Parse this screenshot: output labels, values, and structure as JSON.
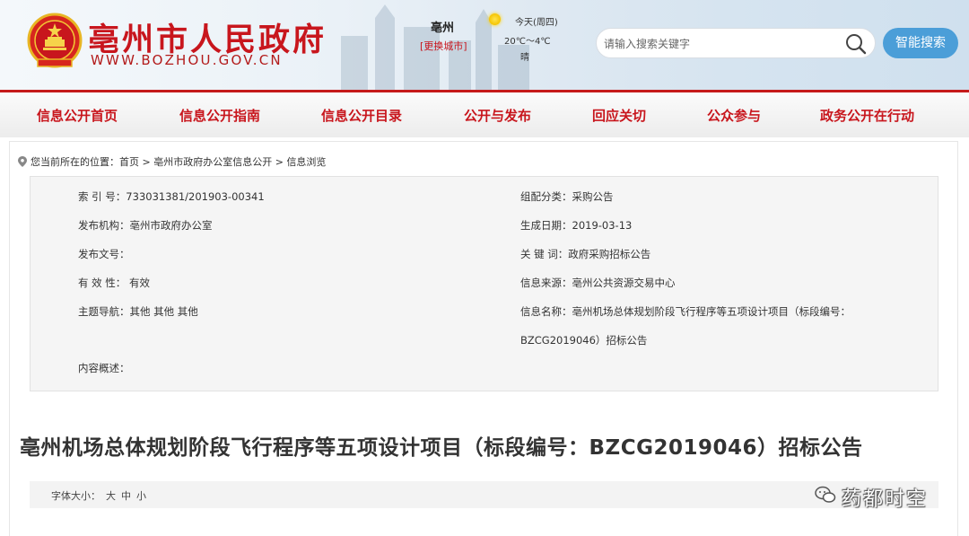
{
  "header": {
    "site_title": "亳州市人民政府",
    "site_url": "WWW.BOZHOU.GOV.CN",
    "city": "亳州",
    "switch_city": "[更换城市]",
    "weather": {
      "day": "今天(周四)",
      "temp": "20℃～4℃",
      "condition": "晴",
      "icon": "sun-icon"
    },
    "search_placeholder": "请输入搜索关键字",
    "smart_search_label": "智能搜索"
  },
  "nav": {
    "items": [
      {
        "label": "信息公开首页"
      },
      {
        "label": "信息公开指南"
      },
      {
        "label": "信息公开目录"
      },
      {
        "label": "公开与发布"
      },
      {
        "label": "回应关切"
      },
      {
        "label": "公众参与"
      },
      {
        "label": "政务公开在行动"
      }
    ]
  },
  "breadcrumb": {
    "prefix": "您当前所在的位置：",
    "home": "首页",
    "sep1": " > ",
    "section": "亳州市政府办公室信息公开",
    "sep2": " > ",
    "current": "信息浏览"
  },
  "info": {
    "index_no": "索 引 号：733031381/201903-00341",
    "category": "组配分类：采购公告",
    "publisher": "发布机构：亳州市政府办公室",
    "date": "生成日期：2019-03-13",
    "doc_no": "发布文号：",
    "keywords": "关 键 词：政府采购招标公告",
    "validity": "有 效 性： 有效",
    "source": "信息来源：亳州公共资源交易中心",
    "topic": "主题导航：其他  其他  其他",
    "name_line1": "信息名称：亳州机场总体规划阶段飞行程序等五项设计项目（标段编号：",
    "name_line2": "BZCG2019046）招标公告",
    "summary": "内容概述："
  },
  "article": {
    "title": "亳州机场总体规划阶段飞行程序等五项设计项目（标段编号：BZCG2019046）招标公告"
  },
  "font_size": {
    "label": "字体大小：",
    "large": "大",
    "medium": "中",
    "small": "小"
  },
  "watermark": {
    "text": "药都时空"
  },
  "colors": {
    "brand_red": "#c8161d",
    "search_button": "#4b9ed8",
    "info_bg": "#f5f5f5"
  }
}
